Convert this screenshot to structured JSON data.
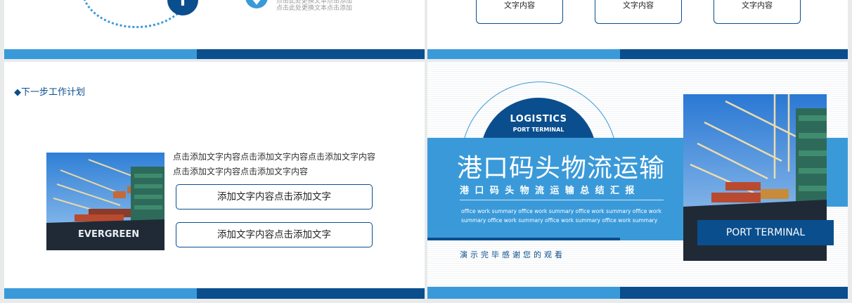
{
  "slide1": {
    "text_lines": [
      "点击此处更换文本点击添加",
      "点击此处更换文本点击添加"
    ]
  },
  "slide2": {
    "boxes": [
      "文字内容",
      "文字内容",
      "文字内容"
    ]
  },
  "slide3": {
    "title": "◆下一步工作计划",
    "para_line1": "点击添加文字内容点击添加文字内容点击添加文字内容",
    "para_line2": "点击添加文字内容点击添加文字内容",
    "button1": "添加文字内容点击添加文字",
    "button2": "添加文字内容点击添加文字",
    "ship_name": "EVERGREEN"
  },
  "slide4": {
    "logistics": "LOGISTICS",
    "port_small": "PORT TERMINAL",
    "main_title": "港口码头物流运输",
    "sub_title": "港口码头物流运输总结汇报",
    "en_text": "office work summary office work summary office work summary office work summary office work summary office work summary office work summary",
    "thanks": "演示完毕感谢您的观看",
    "port_label": "PORT TERMINAL"
  },
  "colors": {
    "accent_light": "#3a9ad9",
    "accent_dark": "#0a4e8e",
    "background": "#e9eaec"
  },
  "icons": [
    "plus-icon",
    "location-pin-icon"
  ]
}
